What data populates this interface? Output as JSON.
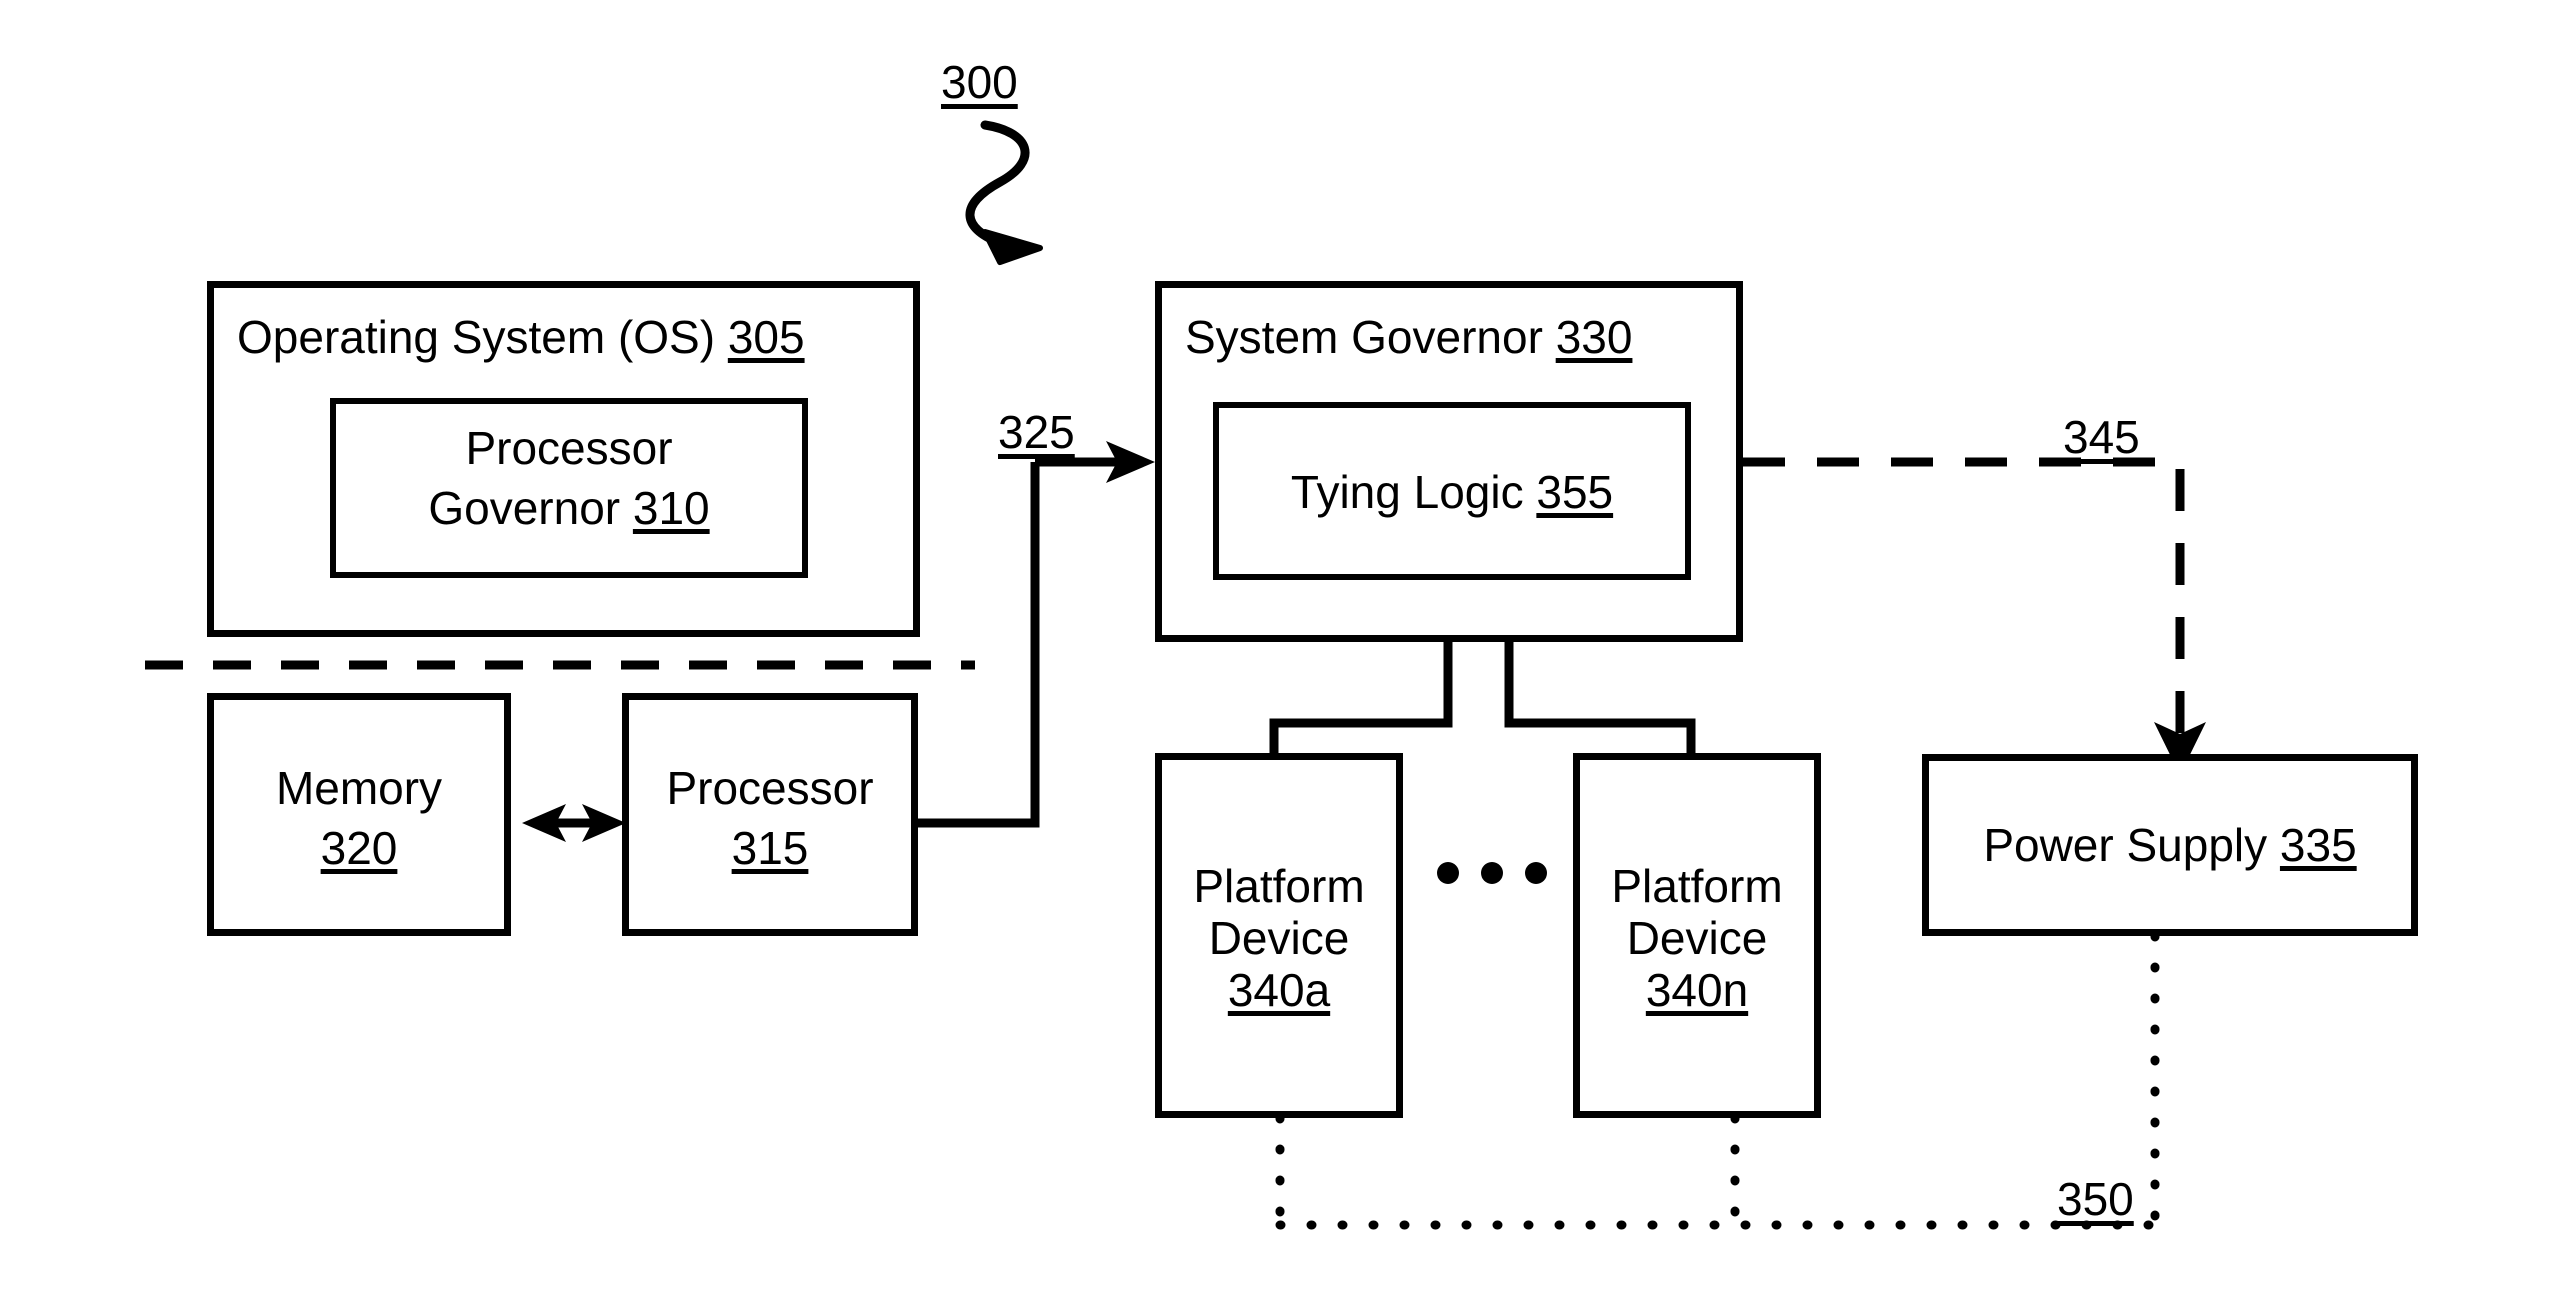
{
  "figure": {
    "reference_numeral": "300",
    "type": "patent-block-diagram"
  },
  "blocks": {
    "os": {
      "title_text": "Operating System (OS) ",
      "title_ref": "305"
    },
    "processor_governor": {
      "line1": "Processor",
      "line2_text": "Governor ",
      "line2_ref": "310"
    },
    "memory": {
      "line1": "Memory",
      "ref": "320"
    },
    "processor": {
      "line1": "Processor",
      "ref": "315"
    },
    "system_governor": {
      "title_text": "System Governor ",
      "title_ref": "330"
    },
    "tying_logic": {
      "title_text": "Tying Logic ",
      "title_ref": "355"
    },
    "platform_device_a": {
      "line1": "Platform",
      "line2": "Device",
      "ref": "340a"
    },
    "platform_device_n": {
      "line1": "Platform",
      "line2": "Device",
      "ref": "340n"
    },
    "power_supply": {
      "title_text": "Power Supply ",
      "title_ref": "335"
    }
  },
  "connectors": {
    "os_to_system_governor_ref": "325",
    "system_governor_to_power_supply_ref": "345",
    "power_supply_to_devices_ref": "350"
  },
  "colors": {
    "stroke": "#000000",
    "background": "#ffffff"
  }
}
